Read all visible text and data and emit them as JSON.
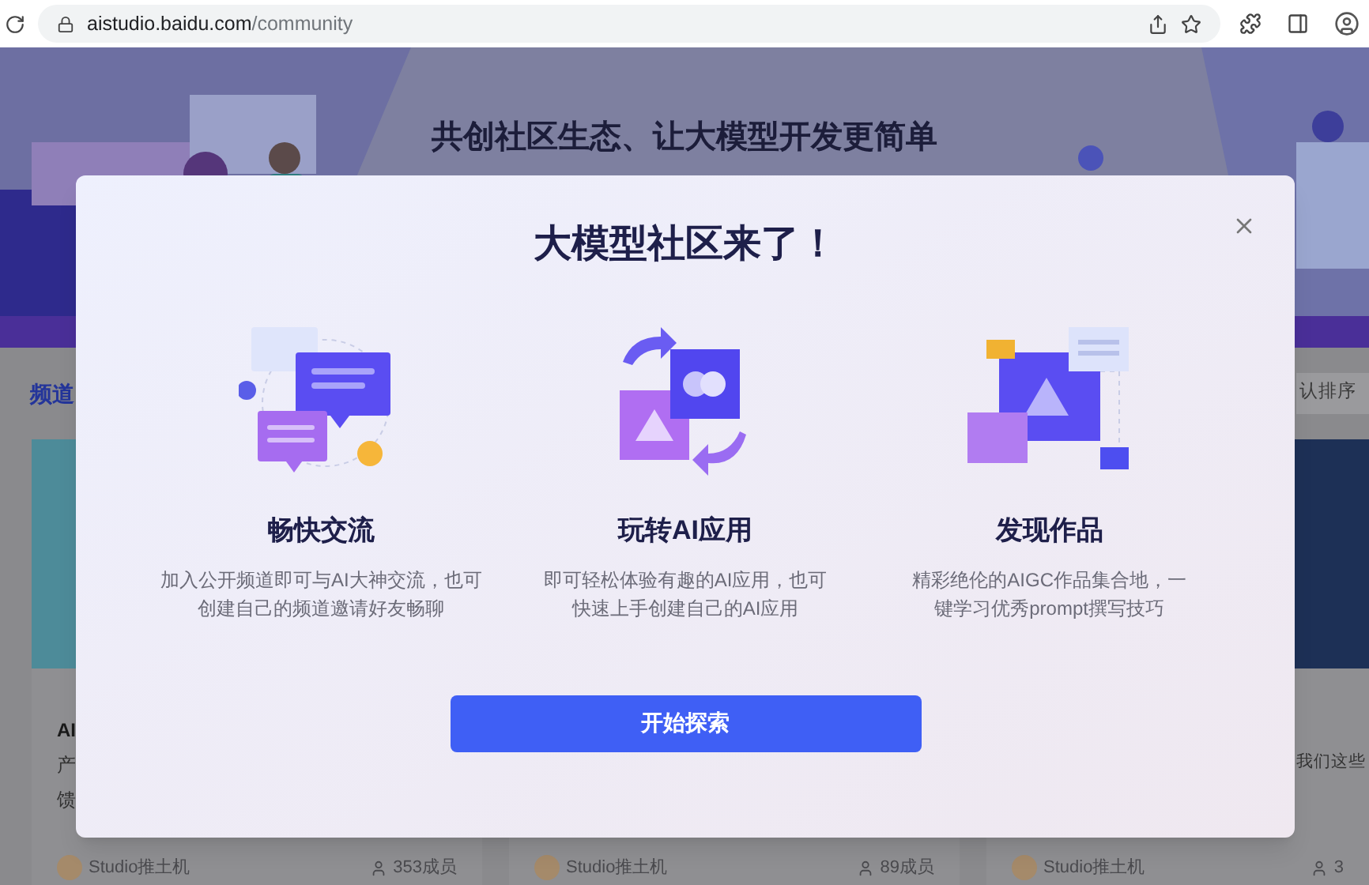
{
  "browser": {
    "url_host": "aistudio.baidu.com",
    "url_path": "/community"
  },
  "banner": {
    "title": "共创社区生态、让大模型开发更简单"
  },
  "page": {
    "section_title": "频道",
    "sort": "认排序"
  },
  "cards": [
    {
      "title": "AI",
      "lines": [
        "产",
        "馈"
      ],
      "author": "Studio推土机",
      "members": "353成员"
    },
    {
      "author": "Studio推土机",
      "members": "89成员"
    },
    {
      "lines": [
        "我们这些"
      ],
      "author": "Studio推土机",
      "members": "3"
    }
  ],
  "modal": {
    "title": "大模型社区来了！",
    "button": "开始探索",
    "features": [
      {
        "kind": "chat",
        "title": "畅快交流",
        "description_lines": [
          "加入公开频道即可与AI大神交流，也可",
          "创建自己的频道邀请好友畅聊"
        ]
      },
      {
        "kind": "apps",
        "title": "玩转AI应用",
        "description_lines": [
          "即可轻松体验有趣的AI应用，也可",
          "快速上手创建自己的AI应用"
        ]
      },
      {
        "kind": "works",
        "title": "发现作品",
        "description_lines": [
          "精彩绝伦的AIGC作品集合地，一",
          "键学习优秀prompt撰写技巧"
        ]
      }
    ]
  }
}
